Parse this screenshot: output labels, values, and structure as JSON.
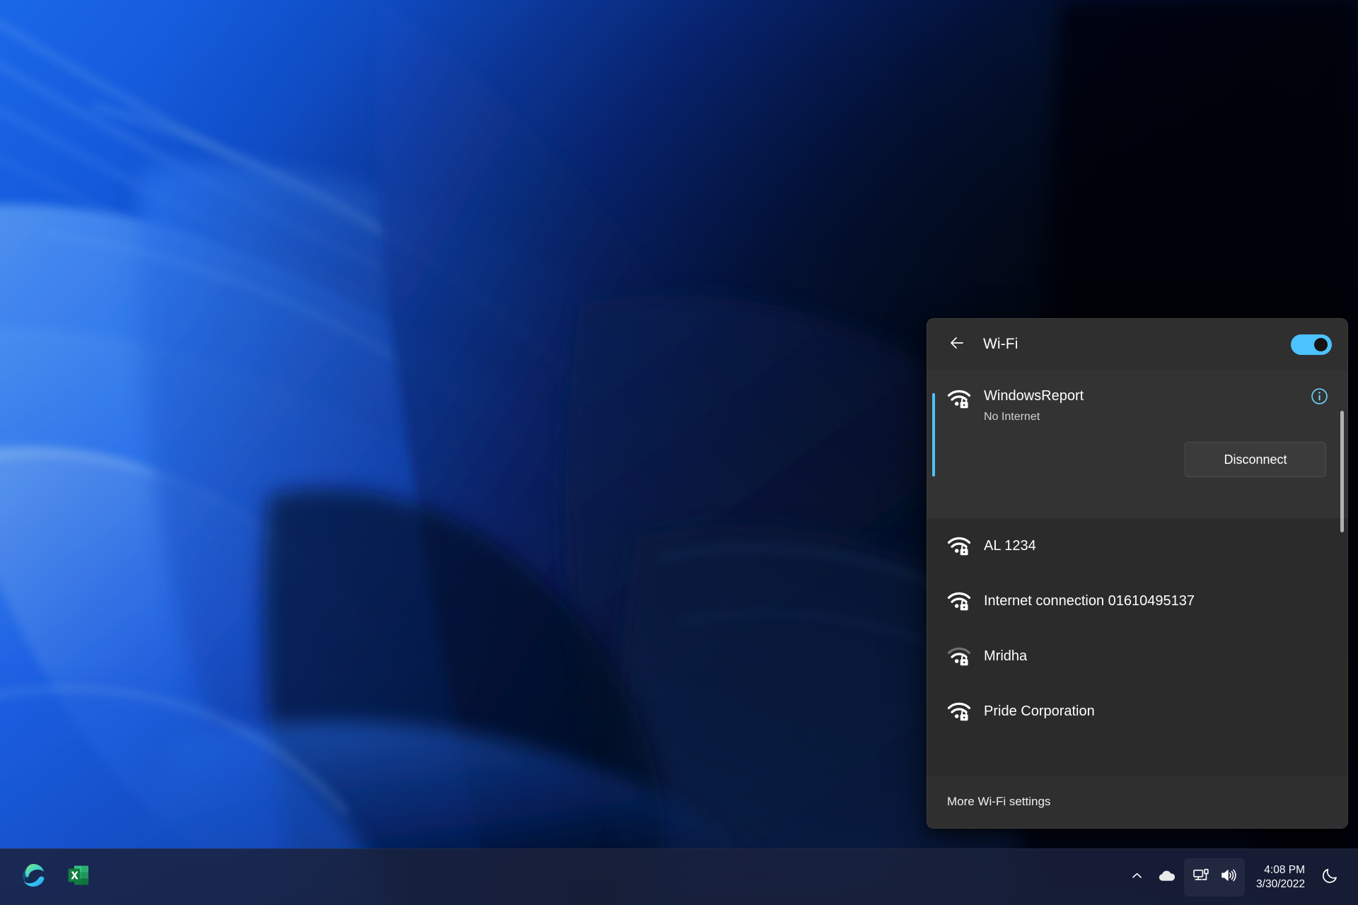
{
  "desktop": {
    "wallpaper_name": "windows-11-bloom-wallpaper",
    "colors": {
      "bright_blue": "#1a6ef5",
      "mid_blue": "#0b3fbd",
      "deep_navy": "#061634",
      "near_black": "#03060f",
      "highlight_cyan": "#6fc0ff"
    }
  },
  "flyout": {
    "name": "wifi-quick-settings-flyout",
    "header": {
      "back_icon": "arrow-left-icon",
      "title": "Wi-Fi",
      "toggle": {
        "name": "wifi-toggle",
        "state": "on",
        "accent_color": "#4cc2ff"
      }
    },
    "connected_network": {
      "icon": "wifi-secured-icon",
      "ssid": "WindowsReport",
      "status": "No Internet",
      "info_icon": "info-circle-icon",
      "info_color": "#6fd0f5",
      "accent_color": "#4cc2ff",
      "action_button": "Disconnect"
    },
    "networks": [
      {
        "icon": "wifi-secured-icon",
        "ssid": "AL 1234",
        "bars": 4
      },
      {
        "icon": "wifi-secured-icon",
        "ssid": "Internet connection 01610495137",
        "bars": 4
      },
      {
        "icon": "wifi-secured-icon",
        "ssid": "Mridha",
        "bars": 3
      },
      {
        "icon": "wifi-secured-icon",
        "ssid": "Pride Corporation",
        "bars": 4
      }
    ],
    "footer": {
      "label": "More Wi-Fi settings",
      "name": "more-wifi-settings-link"
    },
    "scrollbar": {
      "name": "network-list-scrollbar"
    }
  },
  "taskbar": {
    "apps": [
      {
        "name": "microsoft-edge-icon",
        "label": "Microsoft Edge"
      },
      {
        "name": "microsoft-excel-icon",
        "label": "Microsoft Excel"
      }
    ],
    "tray": {
      "show_hidden_icon": "chevron-up-icon",
      "onedrive_icon": "cloud-icon",
      "network_icon": "network-monitor-icon",
      "volume_icon": "speaker-icon",
      "notifications_icon": "moon-icon"
    },
    "clock": {
      "time": "4:08 PM",
      "date": "3/30/2022"
    }
  }
}
